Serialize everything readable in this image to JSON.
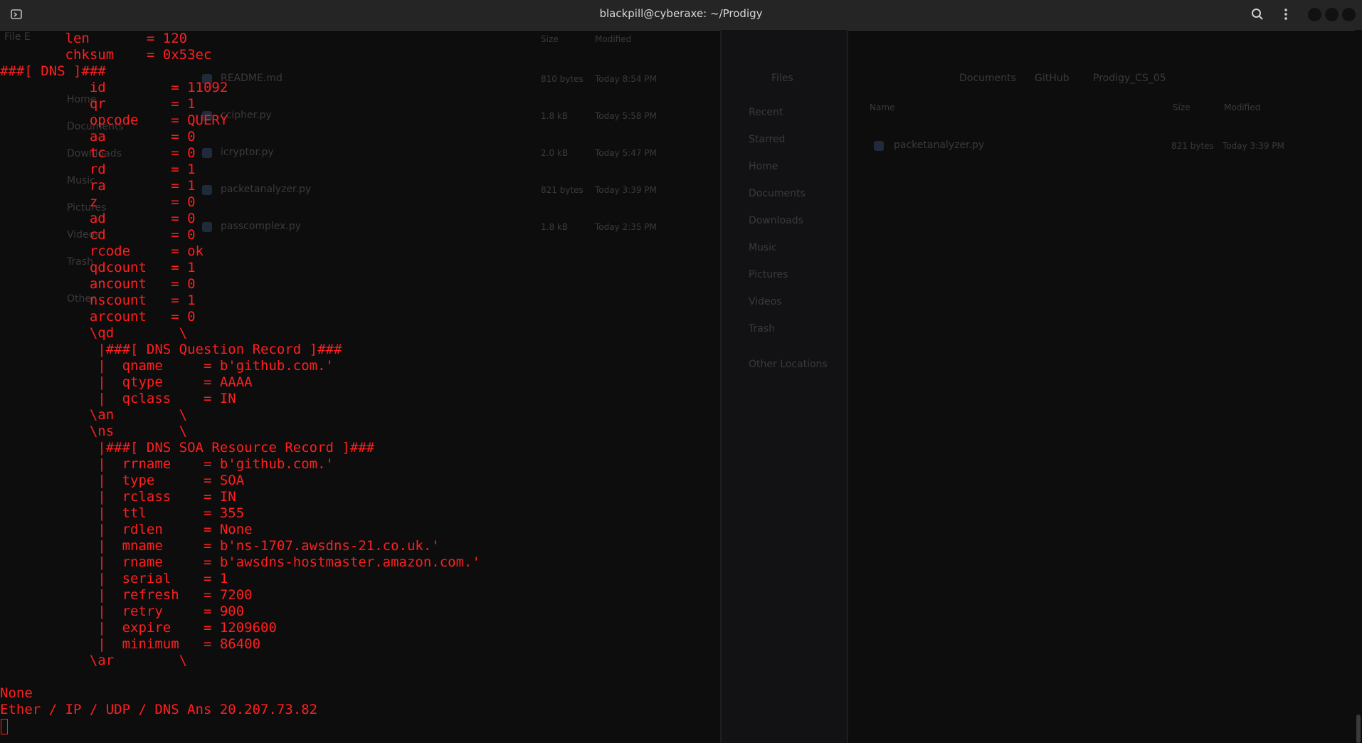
{
  "window": {
    "title": "blackpill@cyberaxe: ~/Prodigy",
    "icons": {
      "app": "terminal-icon",
      "search": "search-icon",
      "menu": "kebab-menu-icon"
    }
  },
  "background_window": {
    "menu": "File  E",
    "sidebar": [
      "Home",
      "Documents",
      "Downloads",
      "Music",
      "Pictures",
      "Videos",
      "Trash",
      "Other"
    ],
    "columns": {
      "size": "Size",
      "modified": "Modified"
    },
    "files": [
      {
        "name": "README.md",
        "size": "810 bytes",
        "modified": "Today 8:54 PM"
      },
      {
        "name": "ccipher.py",
        "size": "1.8 kB",
        "modified": "Today 5:58 PM"
      },
      {
        "name": "icryptor.py",
        "size": "2.0 kB",
        "modified": "Today 5:47 PM"
      },
      {
        "name": "packetanalyzer.py",
        "size": "821 bytes",
        "modified": "Today 3:39 PM"
      },
      {
        "name": "passcomplex.py",
        "size": "1.8 kB",
        "modified": "Today 2:35 PM"
      }
    ],
    "files_panel_title": "Files",
    "places": [
      "Recent",
      "Starred",
      "Home",
      "Documents",
      "Downloads",
      "Music",
      "Pictures",
      "Videos",
      "Trash",
      "Other Locations"
    ],
    "path": [
      "Documents",
      "GitHub",
      "Prodigy_CS_05"
    ],
    "right_columns": {
      "name": "Name",
      "size": "Size",
      "modified": "Modified"
    },
    "right_file": {
      "name": "packetanalyzer.py",
      "size": "821 bytes",
      "modified": "Today 3:39 PM"
    }
  },
  "terminal": {
    "lines": [
      "        len       = 120",
      "        chksum    = 0x53ec",
      "###[ DNS ]###",
      "           id        = 11092",
      "           qr        = 1",
      "           opcode    = QUERY",
      "           aa        = 0",
      "           tc        = 0",
      "           rd        = 1",
      "           ra        = 1",
      "           z         = 0",
      "           ad        = 0",
      "           cd        = 0",
      "           rcode     = ok",
      "           qdcount   = 1",
      "           ancount   = 0",
      "           nscount   = 1",
      "           arcount   = 0",
      "           \\qd        \\",
      "            |###[ DNS Question Record ]###",
      "            |  qname     = b'github.com.'",
      "            |  qtype     = AAAA",
      "            |  qclass    = IN",
      "           \\an        \\",
      "           \\ns        \\",
      "            |###[ DNS SOA Resource Record ]###",
      "            |  rrname    = b'github.com.'",
      "            |  type      = SOA",
      "            |  rclass    = IN",
      "            |  ttl       = 355",
      "            |  rdlen     = None",
      "            |  mname     = b'ns-1707.awsdns-21.co.uk.'",
      "            |  rname     = b'awsdns-hostmaster.amazon.com.'",
      "            |  serial    = 1",
      "            |  refresh   = 7200",
      "            |  retry     = 900",
      "            |  expire    = 1209600",
      "            |  minimum   = 86400",
      "           \\ar        \\",
      "",
      "None",
      "Ether / IP / UDP / DNS Ans 20.207.73.82"
    ]
  },
  "colors": {
    "terminal_text": "#ff1f1f",
    "background": "#0d0d0e",
    "titlebar": "#252526"
  }
}
